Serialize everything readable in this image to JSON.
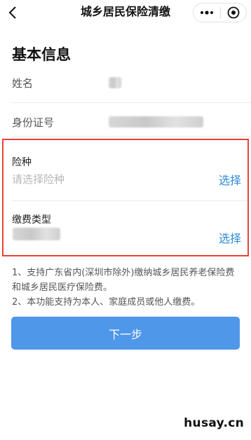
{
  "nav": {
    "title": "城乡居民保险清缴",
    "back_icon": "chevron-left-icon",
    "more_icon": "more-dots-icon",
    "close_icon": "target-close-icon"
  },
  "basic_info": {
    "title": "基本信息",
    "name_label": "姓名",
    "id_label": "身份证号"
  },
  "form": {
    "insurance_label": "险种",
    "insurance_placeholder": "请选择险种",
    "insurance_select": "选择",
    "payment_label": "缴费类型",
    "payment_select": "选择"
  },
  "notes": {
    "line1": "1、支持广东省内(深圳市除外)缴纳城乡居民养老保险费和城乡居民医疗保险费。",
    "line2": "2、本功能支持为本人、家庭成员或他人缴费。"
  },
  "next_button": "下一步",
  "watermark": "husay.cn",
  "colors": {
    "accent": "#2f8ad8",
    "button": "#4f97e8",
    "highlight_border": "#e8413a"
  }
}
